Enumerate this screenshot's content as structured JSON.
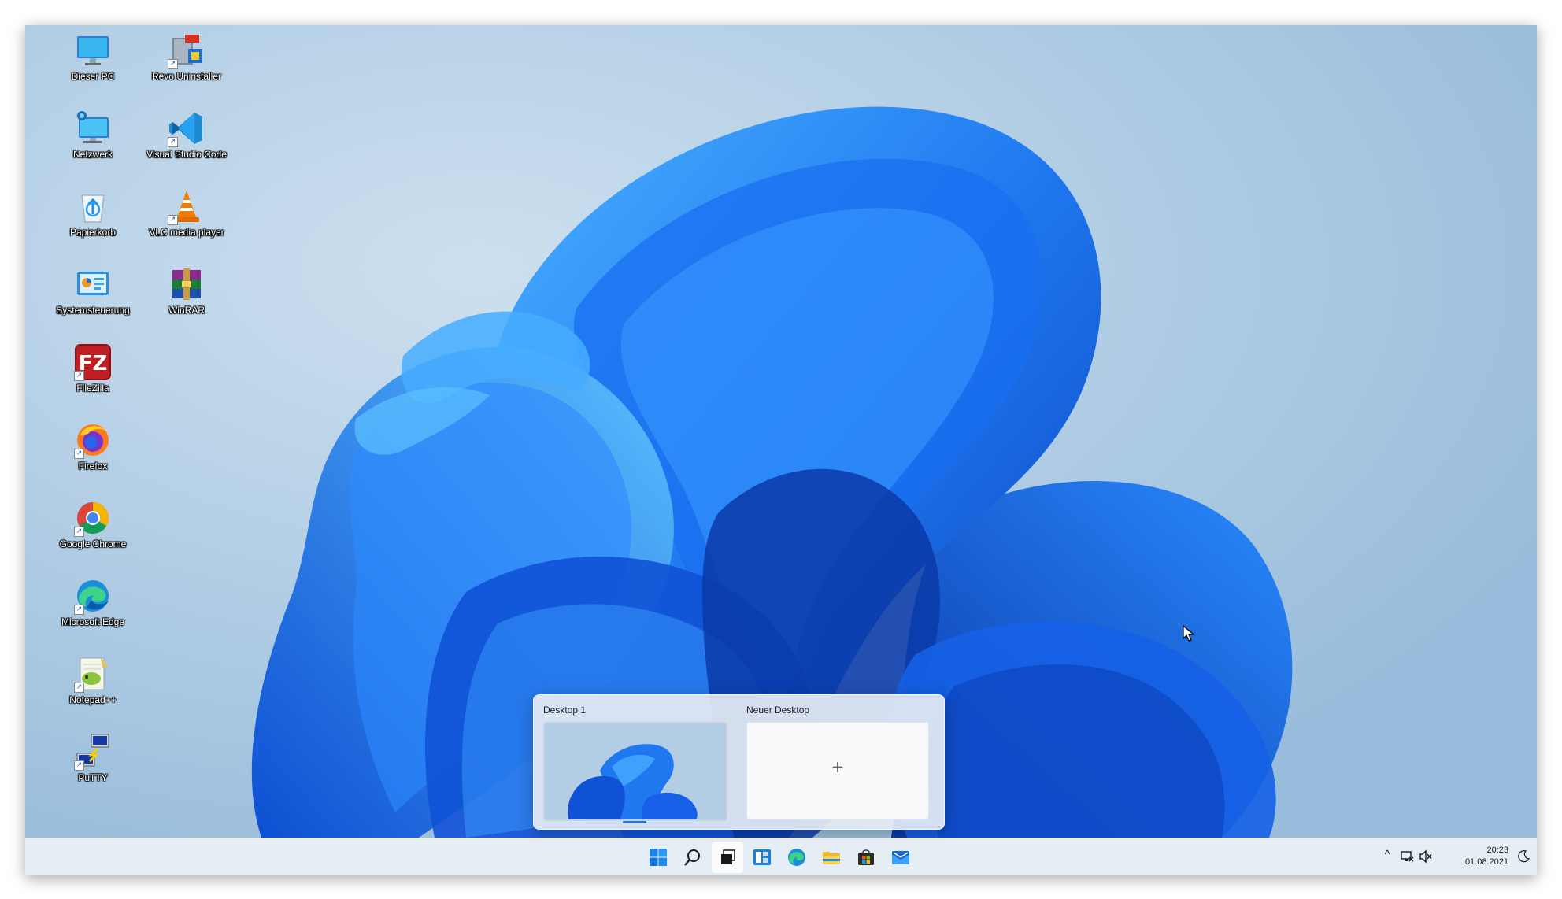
{
  "desktop": {
    "icons": [
      {
        "label": "Dieser PC",
        "icon": "computer-icon"
      },
      {
        "label": "Revo Uninstaller",
        "icon": "revo-uninstaller-icon"
      },
      {
        "label": "Netzwerk",
        "icon": "network-icon"
      },
      {
        "label": "Visual Studio Code",
        "icon": "vscode-icon"
      },
      {
        "label": "Papierkorb",
        "icon": "recycle-bin-icon"
      },
      {
        "label": "VLC media player",
        "icon": "vlc-icon"
      },
      {
        "label": "Systemsteuerung",
        "icon": "control-panel-icon"
      },
      {
        "label": "WinRAR",
        "icon": "winrar-icon"
      },
      {
        "label": "FileZilla",
        "icon": "filezilla-icon"
      },
      {
        "label": "Firefox",
        "icon": "firefox-icon"
      },
      {
        "label": "Google Chrome",
        "icon": "chrome-icon"
      },
      {
        "label": "Microsoft Edge",
        "icon": "edge-icon"
      },
      {
        "label": "Notepad++",
        "icon": "notepadpp-icon"
      },
      {
        "label": "PuTTY",
        "icon": "putty-icon"
      }
    ]
  },
  "task_view": {
    "desktops": [
      {
        "title": "Desktop 1"
      },
      {
        "title": "Neuer Desktop",
        "plus": "+"
      }
    ]
  },
  "taskbar": {
    "items": [
      "start-icon",
      "search-icon",
      "task-view-icon",
      "widgets-icon",
      "edge-icon",
      "file-explorer-icon",
      "store-icon",
      "mail-icon"
    ],
    "active": "task-view-icon",
    "tray": {
      "chevron": "^",
      "time": "20:23",
      "date": "01.08.2021"
    }
  },
  "colors": {
    "accent": "#2f6ad8",
    "bloom_light": "#3aa0ff",
    "bloom_dark": "#0a3fb8"
  }
}
